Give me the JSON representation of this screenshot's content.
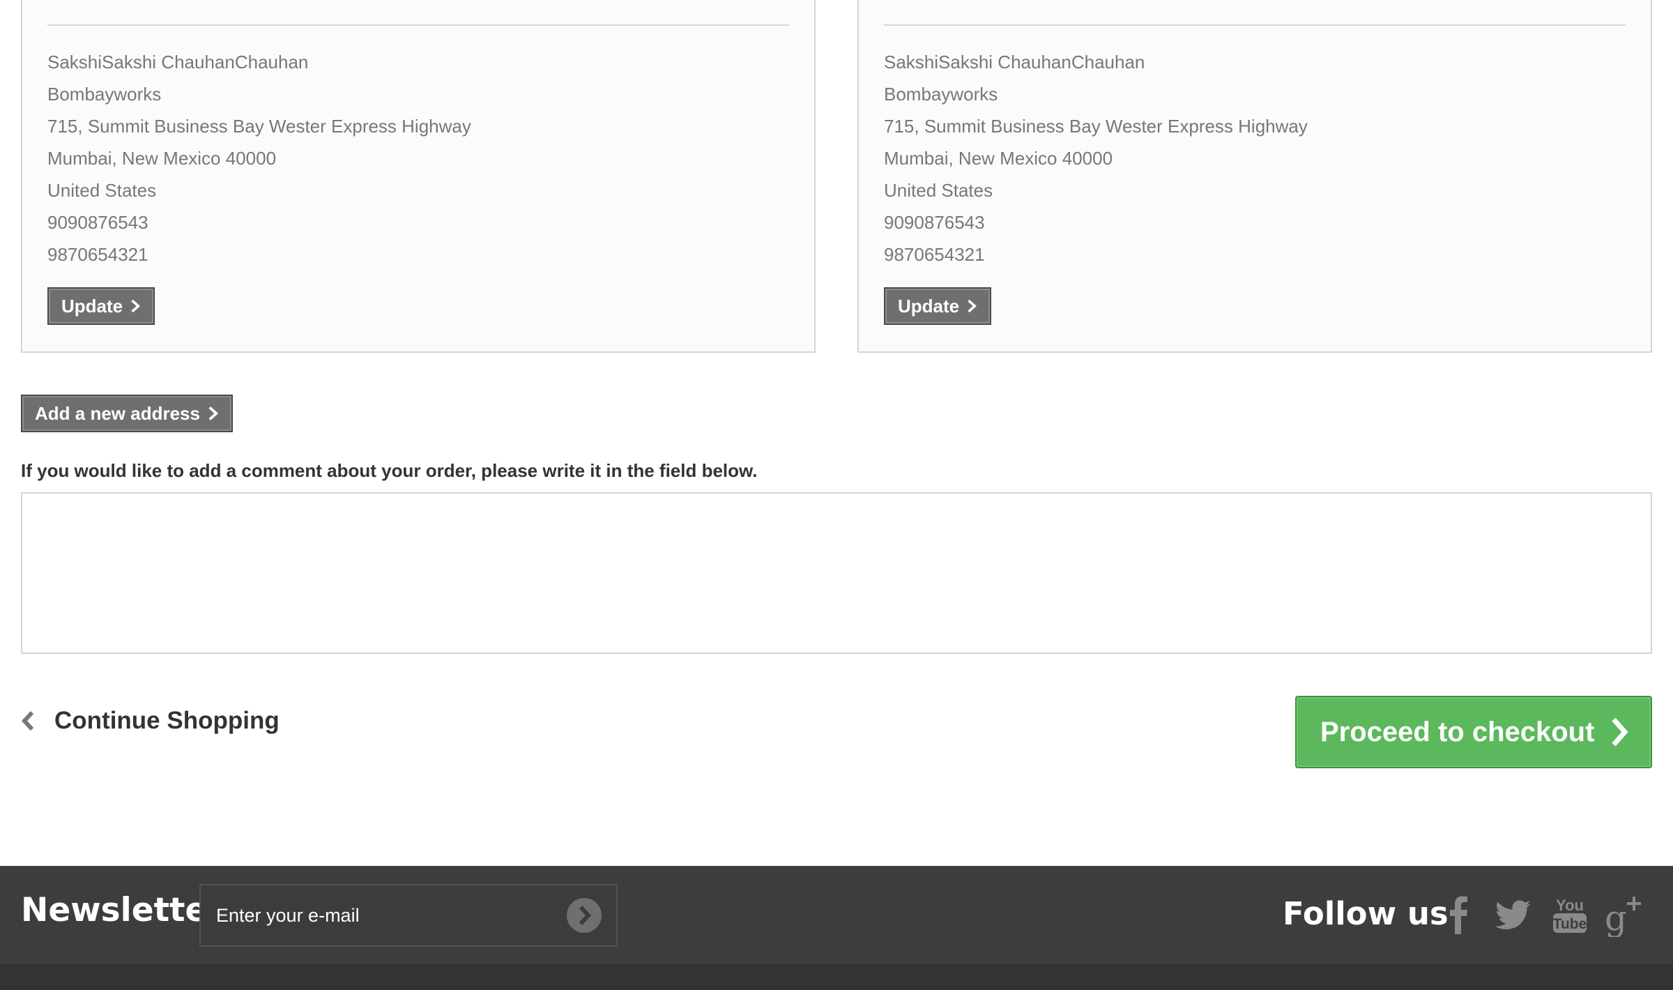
{
  "addresses": [
    {
      "lines": [
        "SakshiSakshi ChauhanChauhan",
        "Bombayworks",
        "715, Summit Business Bay Wester Express Highway",
        "Mumbai, New Mexico 40000",
        "United States",
        "9090876543",
        "9870654321"
      ],
      "update_label": "Update"
    },
    {
      "lines": [
        "SakshiSakshi ChauhanChauhan",
        "Bombayworks",
        "715, Summit Business Bay Wester Express Highway",
        "Mumbai, New Mexico 40000",
        "United States",
        "9090876543",
        "9870654321"
      ],
      "update_label": "Update"
    }
  ],
  "add_address_label": "Add a new address",
  "comment": {
    "label": "If you would like to add a comment about your order, please write it in the field below.",
    "value": ""
  },
  "continue_shopping_label": "Continue Shopping",
  "checkout_label": "Proceed to checkout",
  "footer": {
    "newsletter_title": "Newsletter",
    "newsletter_placeholder": "Enter your e-mail",
    "follow_title": "Follow us",
    "social_icons": [
      "facebook-icon",
      "twitter-icon",
      "youtube-icon",
      "google-plus-icon"
    ]
  },
  "colors": {
    "checkout_green": "#5cb85c",
    "button_grey": "#6f6f6f",
    "footer_bg": "#3d3d3d"
  }
}
